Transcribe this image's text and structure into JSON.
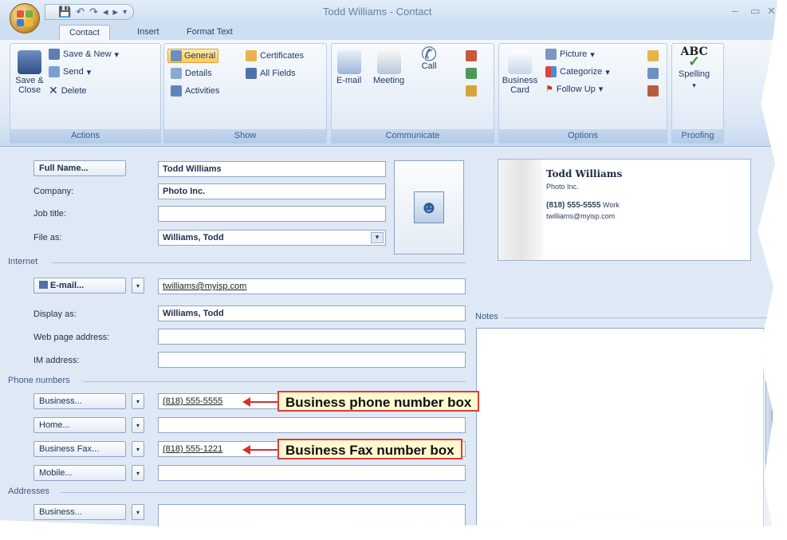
{
  "window": {
    "title": "Todd Williams - Contact",
    "controls": [
      "–",
      "▭",
      "✕"
    ]
  },
  "qat": {
    "icons": [
      "save-icon",
      "undo-icon",
      "redo-icon",
      "previous-icon",
      "next-icon",
      "customize-icon"
    ]
  },
  "tabs": [
    {
      "label": "Contact",
      "active": true
    },
    {
      "label": "Insert",
      "active": false
    },
    {
      "label": "Format Text",
      "active": false
    }
  ],
  "ribbon": {
    "actions": {
      "label": "Actions",
      "save_close": "Save & Close",
      "save_new": "Save & New",
      "send": "Send",
      "delete": "Delete"
    },
    "show": {
      "label": "Show",
      "general": "General",
      "certificates": "Certificates",
      "details": "Details",
      "all_fields": "All Fields",
      "activities": "Activities"
    },
    "communicate": {
      "label": "Communicate",
      "email": "E-mail",
      "meeting": "Meeting",
      "call": "Call"
    },
    "options": {
      "label": "Options",
      "business_card": "Business Card",
      "picture": "Picture",
      "categorize": "Categorize",
      "follow_up": "Follow Up"
    },
    "proofing": {
      "label": "Proofing",
      "spelling": "Spelling",
      "abc": "ABC"
    }
  },
  "form": {
    "full_name_button": "Full Name...",
    "full_name": "Todd Williams",
    "company_label": "Company:",
    "company": "Photo Inc.",
    "job_title_label": "Job title:",
    "job_title": "",
    "file_as_label": "File as:",
    "file_as": "Williams, Todd",
    "internet_section": "Internet",
    "email_button": "E-mail...",
    "email": "twilliams@myisp.com",
    "display_as_label": "Display as:",
    "display_as": "Williams, Todd",
    "web_page_label": "Web page address:",
    "web_page": "",
    "im_label": "IM address:",
    "im": "",
    "phone_section": "Phone numbers",
    "phone_business_button": "Business...",
    "phone_business": "(818) 555-5555",
    "phone_home_button": "Home...",
    "phone_home": "",
    "phone_fax_button": "Business Fax...",
    "phone_fax": "(818) 555-1221",
    "phone_mobile_button": "Mobile...",
    "phone_mobile": "",
    "addresses_section": "Addresses",
    "address_business_button": "Business...",
    "address_business": "",
    "notes_section": "Notes"
  },
  "card": {
    "name": "Todd Williams",
    "company": "Photo Inc.",
    "phone": "(818) 555-5555",
    "phone_type": "Work",
    "email": "twilliams@myisp.com"
  },
  "callouts": {
    "business_phone": "Business phone number box",
    "business_fax": "Business Fax number box"
  },
  "colors": {
    "callout_border": "#d83f3a",
    "callout_fill": "#fff9cf",
    "ribbon_highlight": "#ffc95a"
  }
}
